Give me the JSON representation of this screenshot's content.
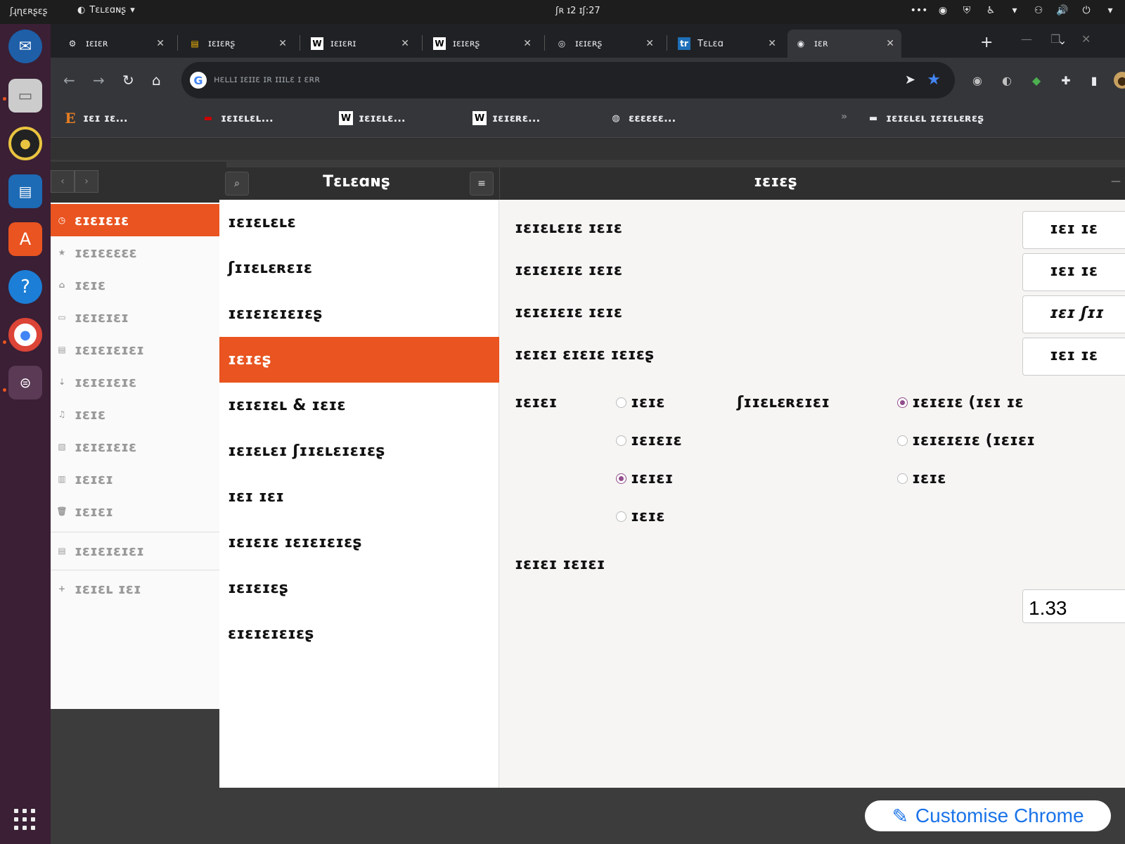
{
  "topbar": {
    "activities": "ʃɻɳɛʀʂɛʂ",
    "app_name": "Tɛʟɛɑɴʂ",
    "clock": "ʃʀ ɪ2 ɪʃ:27"
  },
  "chrome": {
    "tabs": [
      {
        "favicon": "⚙",
        "label": "ɪɛɪɛʀ"
      },
      {
        "favicon": "▤",
        "label": "ɪɛɪɛʀʂ"
      },
      {
        "favicon": "W",
        "label": "ɪɛɪɛʀɪ"
      },
      {
        "favicon": "W",
        "label": "ɪɛɪɛʀʂ"
      },
      {
        "favicon": "◎",
        "label": "ɪɛɪɛʀʂ"
      },
      {
        "favicon": "tr",
        "label": "Tɛʟɛɑ"
      },
      {
        "favicon": "◉",
        "label": "ɪɛʀ"
      }
    ],
    "omnibox_text": "ʜɛʟʟɪ ɪɛɪɪɛ ɪʀ ɪɪɪʟɛ ɪ ɛʀʀ",
    "bookmarks": [
      {
        "icon": "E",
        "label": "ɪɛɪ ɪɛ..."
      },
      {
        "icon": "▬",
        "label": "ɪɛɪɛʟɛʟ..."
      },
      {
        "icon": "W",
        "label": "ɪɛɪɛʟɛ..."
      },
      {
        "icon": "W",
        "label": "ɪɛɪɛʀɛ..."
      },
      {
        "icon": "◍",
        "label": "ɛɛɛɛɛɛ..."
      }
    ],
    "bookmarks_folder": "ɪɛɪɛʟɛʟ ɪɛɪɛʟɛʀɛʂ"
  },
  "nautilus": {
    "items": [
      {
        "icon": "◷",
        "label": "ɛɪɛɪɛɪɛ"
      },
      {
        "icon": "★",
        "label": "ɪɛɪɛɛɛɛɛ"
      },
      {
        "icon": "⌂",
        "label": "ɪɛɪɛ"
      },
      {
        "icon": "▭",
        "label": "ɪɛɪɛɪɛɪ"
      },
      {
        "icon": "▤",
        "label": "ɪɛɪɛɪɛɪɛɪ"
      },
      {
        "icon": "⇣",
        "label": "ɪɛɪɛɪɛɪɛ"
      },
      {
        "icon": "♫",
        "label": "ɪɛɪɛ"
      },
      {
        "icon": "▧",
        "label": "ɪɛɪɛɪɛɪɛ"
      },
      {
        "icon": "▥",
        "label": "ɪɛɪɛɪ"
      },
      {
        "icon": "🗑",
        "label": "ɪɛɪɛɪ"
      },
      {
        "icon": "▤",
        "label": "ɪɛɪɛɪɛɪɛɪ"
      },
      {
        "icon": "+",
        "label": "ɪɛɪɛʟ ɪɛɪ"
      }
    ]
  },
  "settings": {
    "title": "Tɛʟɛɑɴʂ",
    "panel_title": "ɪɛɪɛʂ",
    "sidebar": [
      "ɪɛɪɛʟɛʟɛ",
      "ʃɪɪɛʟɛʀɛɪɛ",
      "ɪɛɪɛɪɛɪɛɪɛʂ",
      "ɪɛɪɛʂ",
      "ɪɛɪɛɪɛʟ & ɪɛɪɛ",
      "ɪɛɪɛʟɛɪ ʃɪɪɛʟɛɪɛɪɛʂ",
      "ɪɛɪ ɪɛɪ",
      "ɪɛɪɛɪɛ ɪɛɪɛɪɛɪɛʂ",
      "ɪɛɪɛɪɛʂ",
      "ɛɪɛɪɛɪɛɪɛʂ"
    ],
    "rows": [
      {
        "label": "ɪɛɪɛʟɛɪɛ ɪɛɪɛ",
        "value": "ɪɛɪ ɪɛ"
      },
      {
        "label": "ɪɛɪɛɪɛɪɛ ɪɛɪɛ",
        "value": "ɪɛɪ ɪɛ"
      },
      {
        "label": "ɪɛɪɛɪɛɪɛ ɪɛɪɛ",
        "value": "ɪɛɪ ʃɪɪ"
      },
      {
        "label": "ɪɛɪɛɪ ɛɪɛɪɛ ɪɛɪɛʂ",
        "value": "ɪɛɪ ɪɛ"
      }
    ],
    "hinting": {
      "label": "ɪɛɪɛɪ",
      "options": [
        {
          "label": "ɪɛɪɛ",
          "checked": false
        },
        {
          "label": "ɪɛɪɛɪɛ",
          "checked": false
        },
        {
          "label": "ɪɛɪɛɪ",
          "checked": true
        },
        {
          "label": "ɪɛɪɛ",
          "checked": false
        }
      ]
    },
    "antialiasing": {
      "label": "ʃɪɪɛʟɛʀɛɪɛɪ",
      "options": [
        {
          "label": "ɪɛɪɛɪɛ (ɪɛɪ ɪɛ",
          "checked": true
        },
        {
          "label": "ɪɛɪɛɪɛɪɛ (ɪɛɪɛɪ",
          "checked": false
        },
        {
          "label": "ɪɛɪɛ",
          "checked": false
        }
      ]
    },
    "scaling_label": "ɪɛɪɛɪ ɪɛɪɛɪ",
    "scaling_value": "1.33"
  },
  "customise_chrome": "Customise Chrome",
  "colors": {
    "accent": "#e95420",
    "radio": "#924d8b",
    "link": "#1a73e8"
  }
}
